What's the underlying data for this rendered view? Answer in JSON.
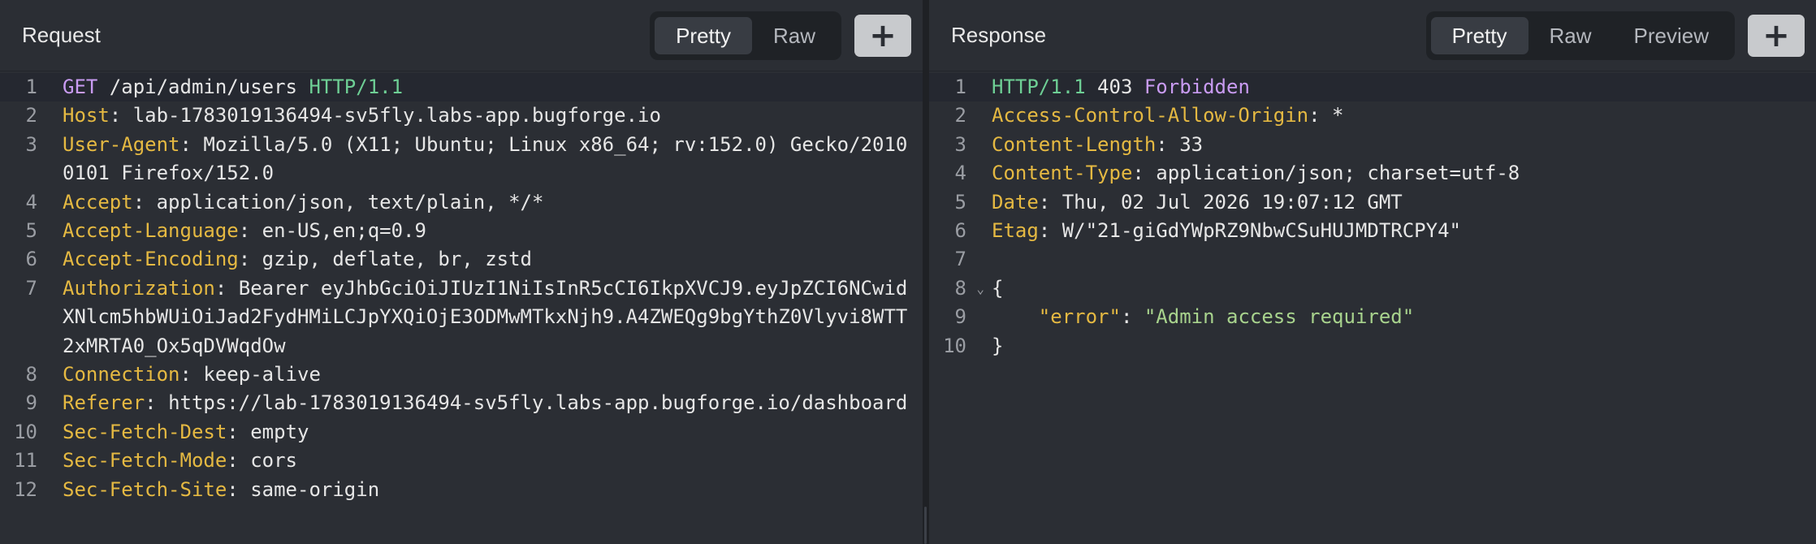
{
  "request": {
    "title": "Request",
    "tabs": {
      "pretty": "Pretty",
      "raw": "Raw"
    },
    "plus": "+",
    "start": {
      "num": "1",
      "method": "GET",
      "path": " /api/admin/users ",
      "proto": "HTTP/1.1"
    },
    "headers": [
      {
        "num": "2",
        "key": "Host",
        "sep": ": ",
        "val": "lab-1783019136494-sv5fly.labs-app.bugforge.io"
      },
      {
        "num": "3",
        "key": "User-Agent",
        "sep": ": ",
        "val": "Mozilla/5.0 (X11; Ubuntu; Linux x86_64; rv:152.0) Gecko/20100101 Firefox/152.0"
      },
      {
        "num": "4",
        "key": "Accept",
        "sep": ": ",
        "val": "application/json, text/plain, */*"
      },
      {
        "num": "5",
        "key": "Accept-Language",
        "sep": ": ",
        "val": "en-US,en;q=0.9"
      },
      {
        "num": "6",
        "key": "Accept-Encoding",
        "sep": ": ",
        "val": "gzip, deflate, br, zstd"
      },
      {
        "num": "7",
        "key": "Authorization",
        "sep": ": ",
        "val": "Bearer eyJhbGciOiJIUzI1NiIsInR5cCI6IkpXVCJ9.eyJpZCI6NCwidXNlcm5hbWUiOiJad2FydHMiLCJpYXQiOjE3ODMwMTkxNjh9.A4ZWEQg9bgYthZ0Vlyvi8WTT2xMRTA0_Ox5qDVWqdOw"
      },
      {
        "num": "8",
        "key": "Connection",
        "sep": ": ",
        "val": "keep-alive"
      },
      {
        "num": "9",
        "key": "Referer",
        "sep": ": ",
        "val": "https://lab-1783019136494-sv5fly.labs-app.bugforge.io/dashboard"
      },
      {
        "num": "10",
        "key": "Sec-Fetch-Dest",
        "sep": ": ",
        "val": "empty"
      },
      {
        "num": "11",
        "key": "Sec-Fetch-Mode",
        "sep": ": ",
        "val": "cors"
      },
      {
        "num": "12",
        "key": "Sec-Fetch-Site",
        "sep": ": ",
        "val": "same-origin"
      }
    ]
  },
  "response": {
    "title": "Response",
    "tabs": {
      "pretty": "Pretty",
      "raw": "Raw",
      "preview": "Preview"
    },
    "plus": "+",
    "status": {
      "num": "1",
      "proto": "HTTP/1.1",
      "code": " 403 ",
      "text": "Forbidden"
    },
    "headers": [
      {
        "num": "2",
        "key": "Access-Control-Allow-Origin",
        "sep": ": ",
        "val": "*"
      },
      {
        "num": "3",
        "key": "Content-Length",
        "sep": ": ",
        "val": "33"
      },
      {
        "num": "4",
        "key": "Content-Type",
        "sep": ": ",
        "val": "application/json; charset=utf-8"
      },
      {
        "num": "5",
        "key": "Date",
        "sep": ": ",
        "val": "Thu, 02 Jul 2026 19:07:12 GMT"
      },
      {
        "num": "6",
        "key": "Etag",
        "sep": ": ",
        "val": "W/\"21-giGdYWpRZ9NbwCSuHUJMDTRCPY4\""
      }
    ],
    "blank_num": "7",
    "body": {
      "open_num": "8",
      "fold": "⌄",
      "open": "{",
      "entry_num": "9",
      "indent": "    ",
      "key": "\"error\"",
      "colon": ": ",
      "value": "\"Admin access required\"",
      "close_num": "10",
      "close": "}"
    }
  }
}
